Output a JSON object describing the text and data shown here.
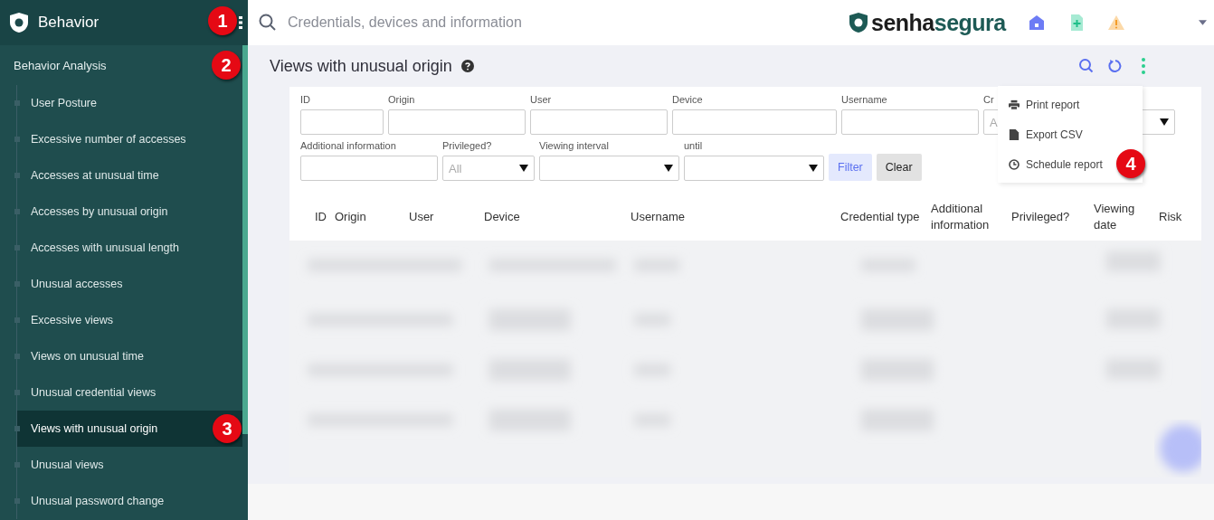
{
  "sidebar": {
    "title": "Behavior",
    "callout": "1",
    "section": {
      "label": "Behavior Analysis",
      "callout": "2"
    },
    "items": [
      {
        "label": "User Posture",
        "selected": false
      },
      {
        "label": "Excessive number of accesses",
        "selected": false
      },
      {
        "label": "Accesses at unusual time",
        "selected": false
      },
      {
        "label": "Accesses by unusual origin",
        "selected": false
      },
      {
        "label": "Accesses with unusual length",
        "selected": false
      },
      {
        "label": "Unusual accesses",
        "selected": false
      },
      {
        "label": "Excessive views",
        "selected": false
      },
      {
        "label": "Views on unusual time",
        "selected": false
      },
      {
        "label": "Unusual credential views",
        "selected": false
      },
      {
        "label": "Views with unusual origin",
        "selected": true,
        "callout": "3"
      },
      {
        "label": "Unusual views",
        "selected": false
      },
      {
        "label": "Unusual password change",
        "selected": false
      }
    ]
  },
  "search": {
    "placeholder": "Credentials, devices and information"
  },
  "brand": {
    "first": "senha",
    "second": "segura"
  },
  "page": {
    "title": "Views with unusual origin"
  },
  "filter_rows": [
    [
      {
        "label": "ID",
        "kind": "input"
      },
      {
        "label": "Origin",
        "kind": "input"
      },
      {
        "label": "User",
        "kind": "input"
      },
      {
        "label": "Device",
        "kind": "input"
      },
      {
        "label": "Username",
        "kind": "input"
      },
      {
        "label": "Cr",
        "kind": "select",
        "value": "A"
      }
    ],
    [
      {
        "label": "Additional information",
        "kind": "input"
      },
      {
        "label": "Privileged?",
        "kind": "select",
        "value": "All"
      },
      {
        "label": "Viewing interval",
        "kind": "select"
      },
      {
        "label": "until",
        "kind": "select"
      }
    ]
  ],
  "buttons": [
    {
      "label": "Filter",
      "kind": "primary"
    },
    {
      "label": "Clear",
      "kind": "secondary"
    }
  ],
  "menu": [
    {
      "label": "Print report",
      "kind": "print"
    },
    {
      "label": "Export CSV",
      "kind": "file"
    },
    {
      "label": "Schedule report",
      "kind": "clock",
      "callout": "4"
    }
  ],
  "table": {
    "columns": [
      "ID",
      "Origin",
      "User",
      "Device",
      "Username",
      "Credential type",
      "Additional information",
      "Privileged?",
      "Viewing date",
      "Risk"
    ]
  }
}
